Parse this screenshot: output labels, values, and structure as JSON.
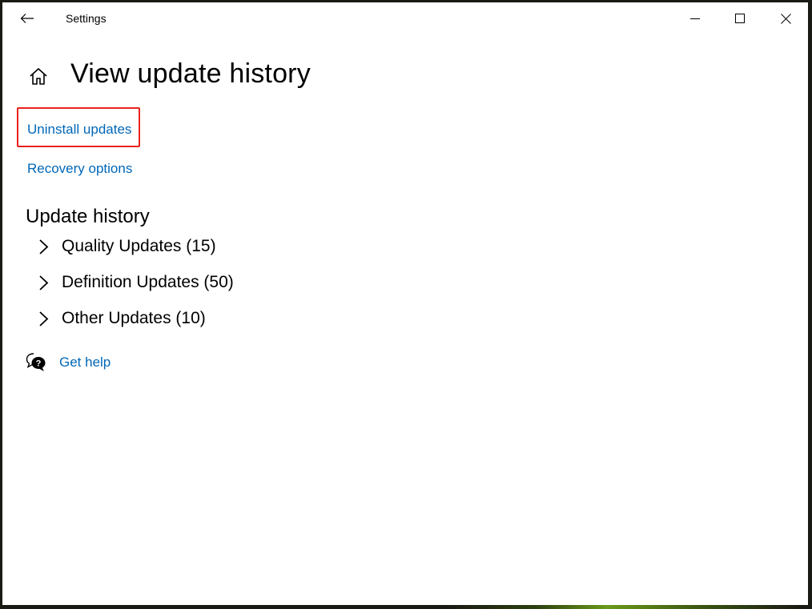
{
  "window": {
    "title": "Settings",
    "controls": {
      "back": "back-arrow-icon",
      "minimize": "minimize-icon",
      "maximize": "maximize-icon",
      "close": "close-icon"
    }
  },
  "page": {
    "title": "View update history",
    "home_icon": "home-icon"
  },
  "links": {
    "uninstall_updates": "Uninstall updates",
    "recovery_options": "Recovery options"
  },
  "highlight": {
    "target": "Uninstall updates",
    "color": "#e8231d"
  },
  "update_history": {
    "heading": "Update history",
    "groups": [
      {
        "label": "Quality Updates (15)",
        "name": "Quality Updates",
        "count": 15,
        "expanded": false
      },
      {
        "label": "Definition Updates (50)",
        "name": "Definition Updates",
        "count": 50,
        "expanded": false
      },
      {
        "label": "Other Updates (10)",
        "name": "Other Updates",
        "count": 10,
        "expanded": false
      }
    ]
  },
  "help": {
    "label": "Get help",
    "icon": "chat-help-icon"
  },
  "colors": {
    "link": "#0067b8",
    "text": "#000000",
    "background": "#ffffff"
  }
}
